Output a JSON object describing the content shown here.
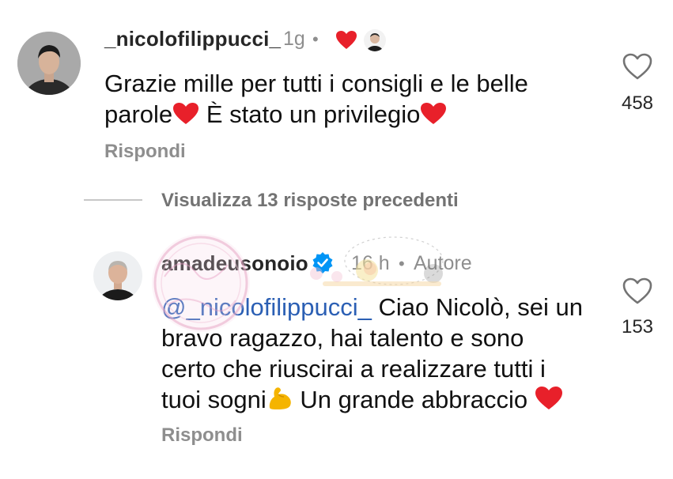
{
  "comments": [
    {
      "username": "_nicolofilippucci_",
      "time": "1g",
      "dot": "•",
      "lines": [
        "Grazie mille per tutti i consigli e le belle",
        "parole",
        "È stato un privilegio"
      ],
      "reply_label": "Rispondi",
      "likes": "458",
      "icons": [
        "heart-emoji",
        "creator-avatar-badge"
      ]
    },
    {
      "username": "amadeusonoio",
      "verified": true,
      "time": "16 h",
      "dot": "•",
      "author_label": "Autore",
      "mention": "@_nicolofilippucci_",
      "lines": [
        "Ciao Nicolò, sei un",
        "bravo ragazzo, hai talento e sono",
        "certo che riuscirai a realizzare tutti i",
        "tuoi sogni",
        "Un grande abbraccio"
      ],
      "reply_label": "Rispondi",
      "likes": "153"
    }
  ],
  "view_replies": "Visualizza 13 risposte precedenti",
  "colors": {
    "text": "#111111",
    "username": "#262626",
    "meta": "#8e8e8e",
    "mention": "#2b5fb4",
    "heart_red": "#e8202a",
    "verified_blue": "#0095f6"
  }
}
